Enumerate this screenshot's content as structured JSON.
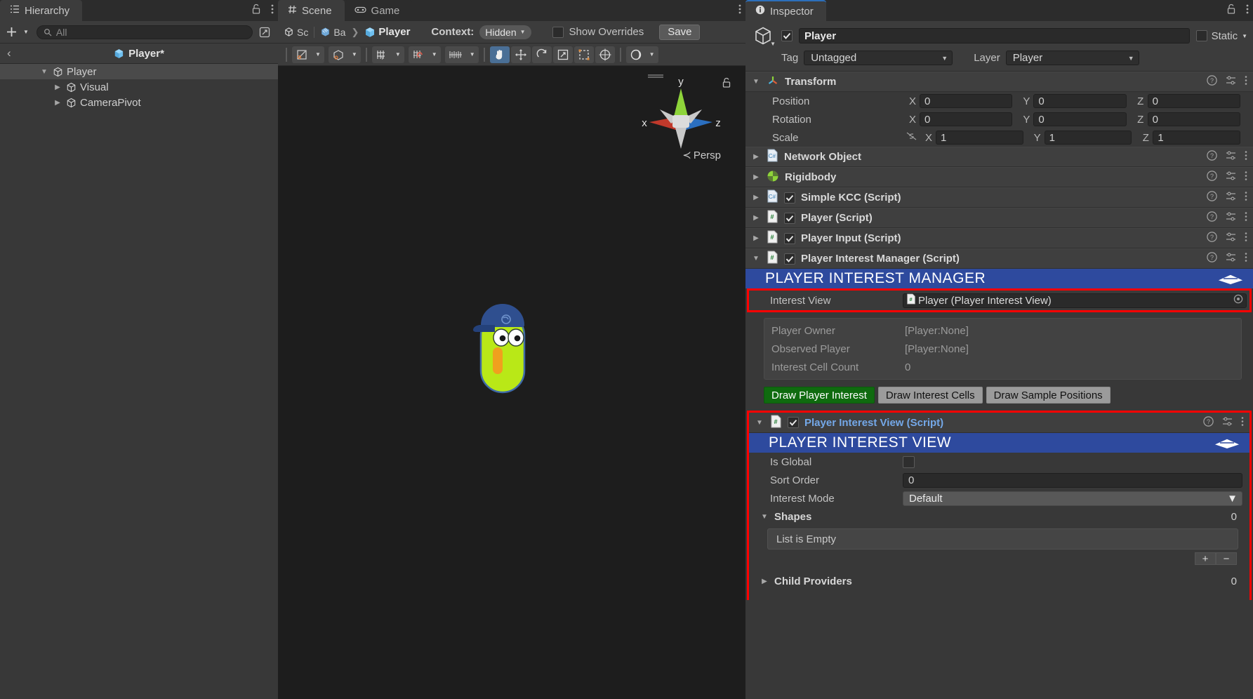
{
  "hierarchy": {
    "tab_label": "Hierarchy",
    "tab_icon": "hierarchy-icon",
    "add_label": "+",
    "search_placeholder": "All",
    "breadcrumb_title": "Player*",
    "tree": [
      {
        "label": "Player",
        "depth": 1,
        "expanded": true,
        "selected": true
      },
      {
        "label": "Visual",
        "depth": 2,
        "expanded": false,
        "selected": false
      },
      {
        "label": "CameraPivot",
        "depth": 2,
        "expanded": false,
        "selected": false
      }
    ]
  },
  "scene": {
    "tabs": [
      {
        "label": "Scene",
        "icon": "hash-icon",
        "active": true
      },
      {
        "label": "Game",
        "icon": "gamepad-icon",
        "active": false
      }
    ],
    "breadcrumb": [
      {
        "label": "Sc",
        "icon": "unity-icon"
      },
      {
        "label": "Ba",
        "icon": "prefab-icon"
      },
      {
        "label": "Player",
        "icon": "cube-blue-icon"
      }
    ],
    "context_label": "Context:",
    "context_value": "Hidden",
    "show_overrides_label": "Show Overrides",
    "show_overrides_checked": false,
    "save_label": "Save",
    "gizmo": {
      "axis_x": "x",
      "axis_y": "y",
      "axis_z": "z",
      "projection": "Persp",
      "color_x": "#c0392b",
      "color_y": "#8ed43a",
      "color_z": "#2b6fc0"
    },
    "toolbar_tools": [
      "shading-mode-dropdown",
      "2d-mode-dropdown",
      "lighting-toggle",
      "audio-toggle",
      "fx-dropdown",
      "hand-tool",
      "move-tool",
      "rotate-tool",
      "scale-tool",
      "rect-tool",
      "transform-tool",
      "gizmo-visibility-dropdown"
    ]
  },
  "inspector": {
    "tab_label": "Inspector",
    "tab_icon": "info-icon",
    "object": {
      "enabled": true,
      "name": "Player",
      "static_label": "Static",
      "static_checked": false,
      "tag_label": "Tag",
      "tag_value": "Untagged",
      "layer_label": "Layer",
      "layer_value": "Player"
    },
    "transform": {
      "title": "Transform",
      "expanded": true,
      "rows": [
        {
          "label": "Position",
          "x": "0",
          "y": "0",
          "z": "0",
          "has_link": false
        },
        {
          "label": "Rotation",
          "x": "0",
          "y": "0",
          "z": "0",
          "has_link": false
        },
        {
          "label": "Scale",
          "x": "1",
          "y": "1",
          "z": "1",
          "has_link": true
        }
      ],
      "axis_labels": [
        "X",
        "Y",
        "Z"
      ]
    },
    "components": [
      {
        "title": "Network Object",
        "icon": "cs-script-icon",
        "expanded": false,
        "has_checkbox": false,
        "checked": false
      },
      {
        "title": "Rigidbody",
        "icon": "rigidbody-icon",
        "expanded": false,
        "has_checkbox": false,
        "checked": false
      },
      {
        "title": "Simple KCC (Script)",
        "icon": "cs-script-icon",
        "expanded": false,
        "has_checkbox": true,
        "checked": true
      },
      {
        "title": "Player (Script)",
        "icon": "hash-script-icon",
        "expanded": false,
        "has_checkbox": true,
        "checked": true
      },
      {
        "title": "Player Input (Script)",
        "icon": "hash-script-icon",
        "expanded": false,
        "has_checkbox": true,
        "checked": true
      },
      {
        "title": "Player Interest Manager (Script)",
        "icon": "hash-script-icon",
        "expanded": true,
        "has_checkbox": true,
        "checked": true
      }
    ],
    "interest_manager": {
      "banner_title": "PLAYER INTEREST MANAGER",
      "banner_color": "#2e4a9e",
      "interest_view_label": "Interest View",
      "interest_view_value": "Player (Player Interest View)",
      "readonly_rows": [
        {
          "label": "Player Owner",
          "value": "[Player:None]"
        },
        {
          "label": "Observed Player",
          "value": "[Player:None]"
        },
        {
          "label": "Interest Cell Count",
          "value": "0"
        }
      ],
      "buttons": [
        {
          "label": "Draw Player Interest",
          "active": true
        },
        {
          "label": "Draw Interest Cells",
          "active": false
        },
        {
          "label": "Draw Sample Positions",
          "active": false
        }
      ],
      "active_button_color": "#0f6b0f"
    },
    "interest_view_component": {
      "title": "Player Interest View (Script)",
      "icon": "hash-script-icon",
      "expanded": true,
      "checked": true,
      "banner_title": "PLAYER INTEREST VIEW",
      "banner_color": "#2e4a9e",
      "properties": [
        {
          "label": "Is Global",
          "type": "checkbox",
          "value": "",
          "checked": false
        },
        {
          "label": "Sort Order",
          "type": "number",
          "value": "0"
        },
        {
          "label": "Interest Mode",
          "type": "select",
          "value": "Default"
        }
      ],
      "shapes": {
        "label": "Shapes",
        "count": "0",
        "expanded": true,
        "empty_text": "List is Empty",
        "add_label": "+",
        "remove_label": "−"
      },
      "child_providers": {
        "label": "Child Providers",
        "count": "0",
        "expanded": false
      }
    },
    "highlight_color": "#ff0000"
  }
}
